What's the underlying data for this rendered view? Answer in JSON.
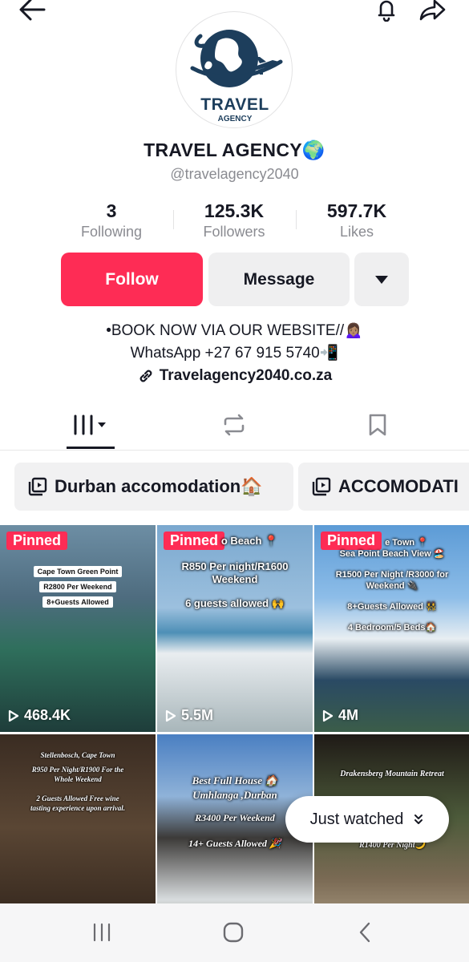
{
  "profile": {
    "avatar_line1": "TRAVEL",
    "avatar_line2": "AGENCY",
    "name": "TRAVEL AGENCY🌍",
    "handle": "@travelagency2040"
  },
  "stats": [
    {
      "value": "3",
      "label": "Following"
    },
    {
      "value": "125.3K",
      "label": "Followers"
    },
    {
      "value": "597.7K",
      "label": "Likes"
    }
  ],
  "actions": {
    "follow": "Follow",
    "message": "Message"
  },
  "bio": {
    "line1": "•BOOK NOW VIA OUR WEBSITE//🙍🏽‍♀️",
    "line2": "WhatsApp +27 67 915 5740📲",
    "link": "Travelagency2040.co.za"
  },
  "playlists": [
    {
      "label": "Durban accomodation🏠"
    },
    {
      "label": "ACCOMODATI"
    }
  ],
  "videos": [
    {
      "pinned": "Pinned",
      "views": "468.4K",
      "captions": [
        "Cape Town Green Point",
        "R2800 Per Weekend",
        "8+Guests Allowed"
      ]
    },
    {
      "pinned": "Pinned",
      "views": "5.5M",
      "captions": [
        "o Beach 📍",
        "R850 Per night/R1600 Weekend",
        "6 guests allowed 🙌"
      ]
    },
    {
      "pinned": "Pinned",
      "views": "4M",
      "captions": [
        "e Town 📍",
        "Sea Point Beach View 🏖️",
        "R1500 Per Night /R3000 for Weekend 🔌",
        "8+Guests Allowed 👯",
        "4 Bedroom/5 Beds🏠"
      ]
    },
    {
      "captions": [
        "Stellenbosch, Cape Town",
        "R950 Per Night/R1900 For the Whole Weekend",
        "2 Guests Allowed Free wine tasting experience upon arrival."
      ]
    },
    {
      "captions": [
        "Best Full House 🏠",
        "Umhlanga ,Durban",
        "R3400 Per Weekend",
        "14+ Guests Allowed 🎉"
      ]
    },
    {
      "captions": [
        "Drakensberg Mountain Retreat",
        "R1400 Per Night🌙"
      ]
    }
  ],
  "just_watched": "Just watched"
}
